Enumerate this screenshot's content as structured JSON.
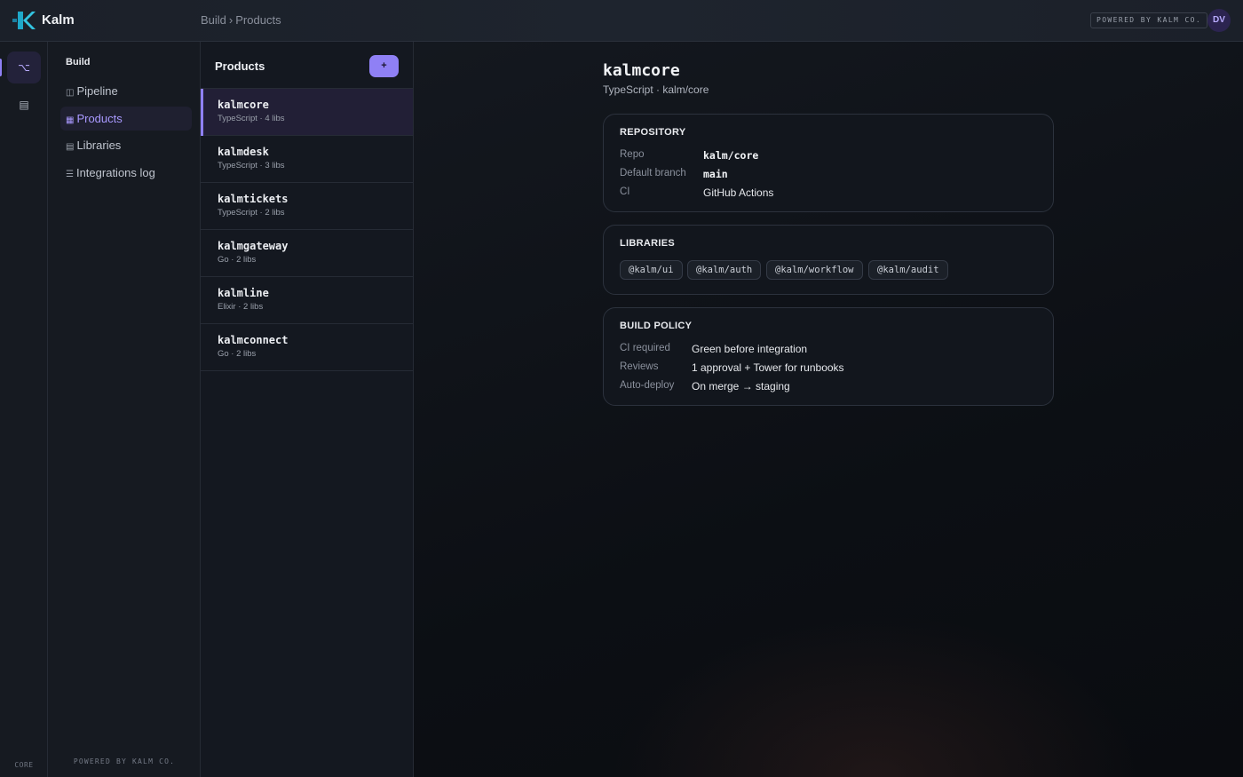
{
  "app": {
    "name": "Kalm",
    "breadcrumb": [
      "Build",
      "Products"
    ],
    "breadcrumb_sep": "›",
    "powered_badge": "POWERED BY KALM CO.",
    "avatar_initials": "DV",
    "accent": "#8f80f5"
  },
  "rail": {
    "items": [
      {
        "icon": "branch-icon",
        "glyph": "⌥",
        "active": true
      },
      {
        "icon": "table-icon",
        "glyph": "▤",
        "active": false
      }
    ],
    "footer": "CORE"
  },
  "nav": {
    "heading": "Build",
    "items": [
      {
        "label": "Pipeline",
        "icon": "columns-icon",
        "glyph": "◫",
        "active": false
      },
      {
        "label": "Products",
        "icon": "grid-icon",
        "glyph": "▦",
        "active": true
      },
      {
        "label": "Libraries",
        "icon": "library-icon",
        "glyph": "▤",
        "active": false
      },
      {
        "label": "Integrations log",
        "icon": "list-icon",
        "glyph": "☰",
        "active": false
      }
    ],
    "footer": "POWERED BY KALM CO."
  },
  "products": {
    "title": "Products",
    "add_label": "+",
    "items": [
      {
        "name": "kalmcore",
        "meta": "TypeScript · 4 libs",
        "selected": true
      },
      {
        "name": "kalmdesk",
        "meta": "TypeScript · 3 libs",
        "selected": false
      },
      {
        "name": "kalmtickets",
        "meta": "TypeScript · 2 libs",
        "selected": false
      },
      {
        "name": "kalmgateway",
        "meta": "Go · 2 libs",
        "selected": false
      },
      {
        "name": "kalmline",
        "meta": "Elixir · 2 libs",
        "selected": false
      },
      {
        "name": "kalmconnect",
        "meta": "Go · 2 libs",
        "selected": false
      }
    ]
  },
  "detail": {
    "title": "kalmcore",
    "subtitle": "TypeScript · kalm/core",
    "repository": {
      "heading": "REPOSITORY",
      "rows": [
        {
          "label": "Repo",
          "value": "kalm/core"
        },
        {
          "label": "Default branch",
          "value": "main"
        },
        {
          "label": "CI",
          "value": "GitHub Actions"
        }
      ]
    },
    "libraries": {
      "heading": "LIBRARIES",
      "items": [
        "@kalm/ui",
        "@kalm/auth",
        "@kalm/workflow",
        "@kalm/audit"
      ]
    },
    "build_policy": {
      "heading": "BUILD POLICY",
      "rows": [
        {
          "label": "CI required",
          "value": "Green before integration"
        },
        {
          "label": "Reviews",
          "value": "1 approval + Tower for runbooks"
        },
        {
          "label": "Auto-deploy",
          "value": "On merge → staging"
        }
      ]
    }
  }
}
